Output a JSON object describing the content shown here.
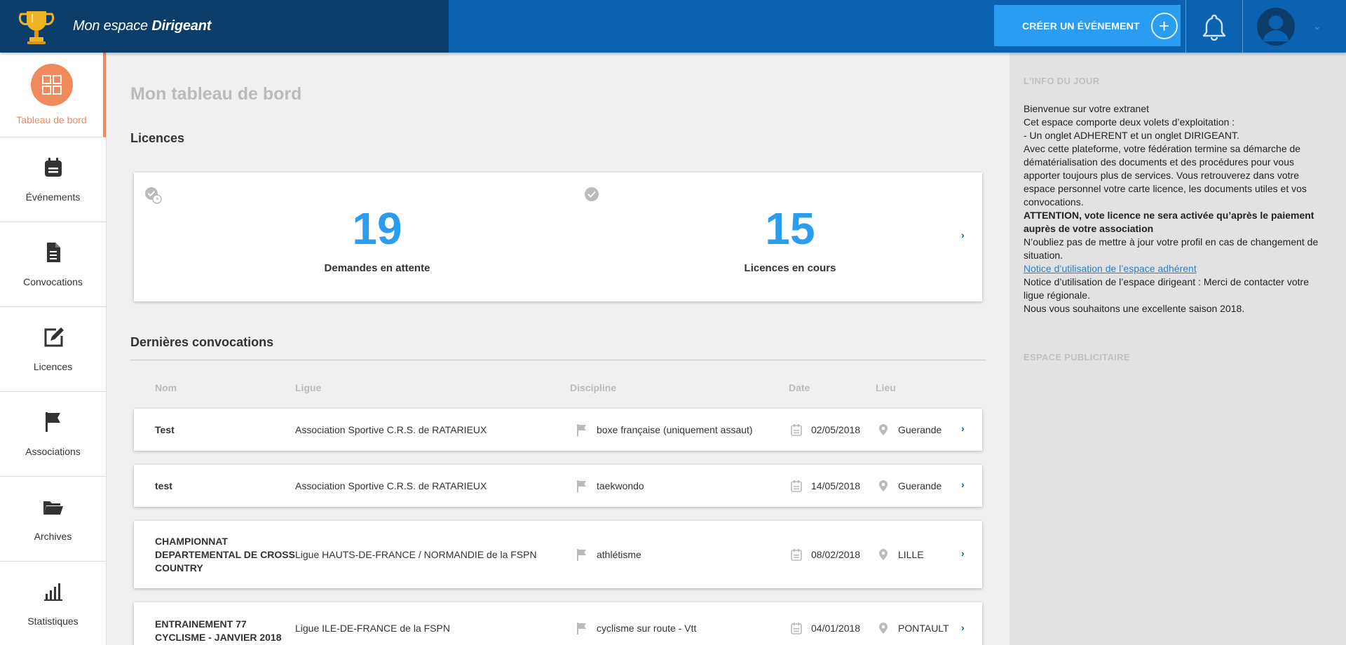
{
  "header": {
    "title_prefix": "Mon espace",
    "title_strong": "Dirigeant",
    "create_label": "CRÉER UN ÉVÉNEMENT",
    "create_plus": "+",
    "user_caret": "⌄"
  },
  "sidebar": {
    "items": [
      {
        "label": "Tableau de bord",
        "icon": "dashboard-icon"
      },
      {
        "label": "Événements",
        "icon": "calendar-icon"
      },
      {
        "label": "Convocations",
        "icon": "document-icon"
      },
      {
        "label": "Licences",
        "icon": "edit-icon"
      },
      {
        "label": "Associations",
        "icon": "flag-icon"
      },
      {
        "label": "Archives",
        "icon": "folder-icon"
      },
      {
        "label": "Statistiques",
        "icon": "bar-chart-icon"
      }
    ]
  },
  "main": {
    "page_title": "Mon tableau de bord",
    "licences_title": "Licences",
    "stats": [
      {
        "value": "19",
        "caption": "Demandes en attente"
      },
      {
        "value": "15",
        "caption": "Licences en cours"
      }
    ],
    "convocations_title": "Dernières convocations",
    "columns": [
      "Nom",
      "Ligue",
      "Discipline",
      "Date",
      "Lieu"
    ],
    "rows": [
      {
        "nom": "Test",
        "ligue": "Association Sportive C.R.S. de RATARIEUX",
        "discipline": "boxe française (uniquement assaut)",
        "date": "02/05/2018",
        "lieu": "Guerande"
      },
      {
        "nom": "test",
        "ligue": "Association Sportive C.R.S. de RATARIEUX",
        "discipline": "taekwondo",
        "date": "14/05/2018",
        "lieu": "Guerande"
      },
      {
        "nom": "CHAMPIONNAT DEPARTEMENTAL DE CROSS COUNTRY",
        "ligue": "Ligue HAUTS-DE-FRANCE / NORMANDIE de la FSPN",
        "discipline": "athlétisme",
        "date": "08/02/2018",
        "lieu": "LILLE"
      },
      {
        "nom": "ENTRAINEMENT 77 CYCLISME - JANVIER 2018",
        "ligue": "Ligue ILE-DE-FRANCE de la FSPN",
        "discipline": "cyclisme sur route - Vtt",
        "date": "04/01/2018",
        "lieu": "PONTAULT"
      }
    ]
  },
  "right": {
    "info_title": "L'INFO DU JOUR",
    "info_lines": [
      "Bienvenue sur votre extranet",
      "Cet espace comporte deux volets d’exploitation :",
      "- Un onglet ADHERENT et un onglet DIRIGEANT.",
      "Avec cette plateforme, votre fédération termine sa démarche de dématérialisation des documents et des procédures pour vous apporter toujours plus de services. Vous retrouverez dans votre espace personnel votre carte licence, les documents utiles et vos convocations."
    ],
    "info_warning": "ATTENTION, vote licence ne sera activée qu’après le paiement auprès de votre association",
    "info_update": "N’oubliez pas de mettre à jour votre profil en cas de changement de situation.",
    "notice_link": "Notice d’utilisation de l’espace adhérent",
    "notice_dirigeant": "Notice d’utilisation de l’espace dirigeant : Merci de contacter votre ligue régionale.",
    "season_wish": "Nous vous souhaitons une excellente saison 2018.",
    "pub_title": "ESPACE PUBLICITAIRE"
  },
  "colors": {
    "topbar": "#0a62b0",
    "brand": "#0b3d6b",
    "accent": "#2a9df0",
    "active_nav": "#f08a5d"
  }
}
